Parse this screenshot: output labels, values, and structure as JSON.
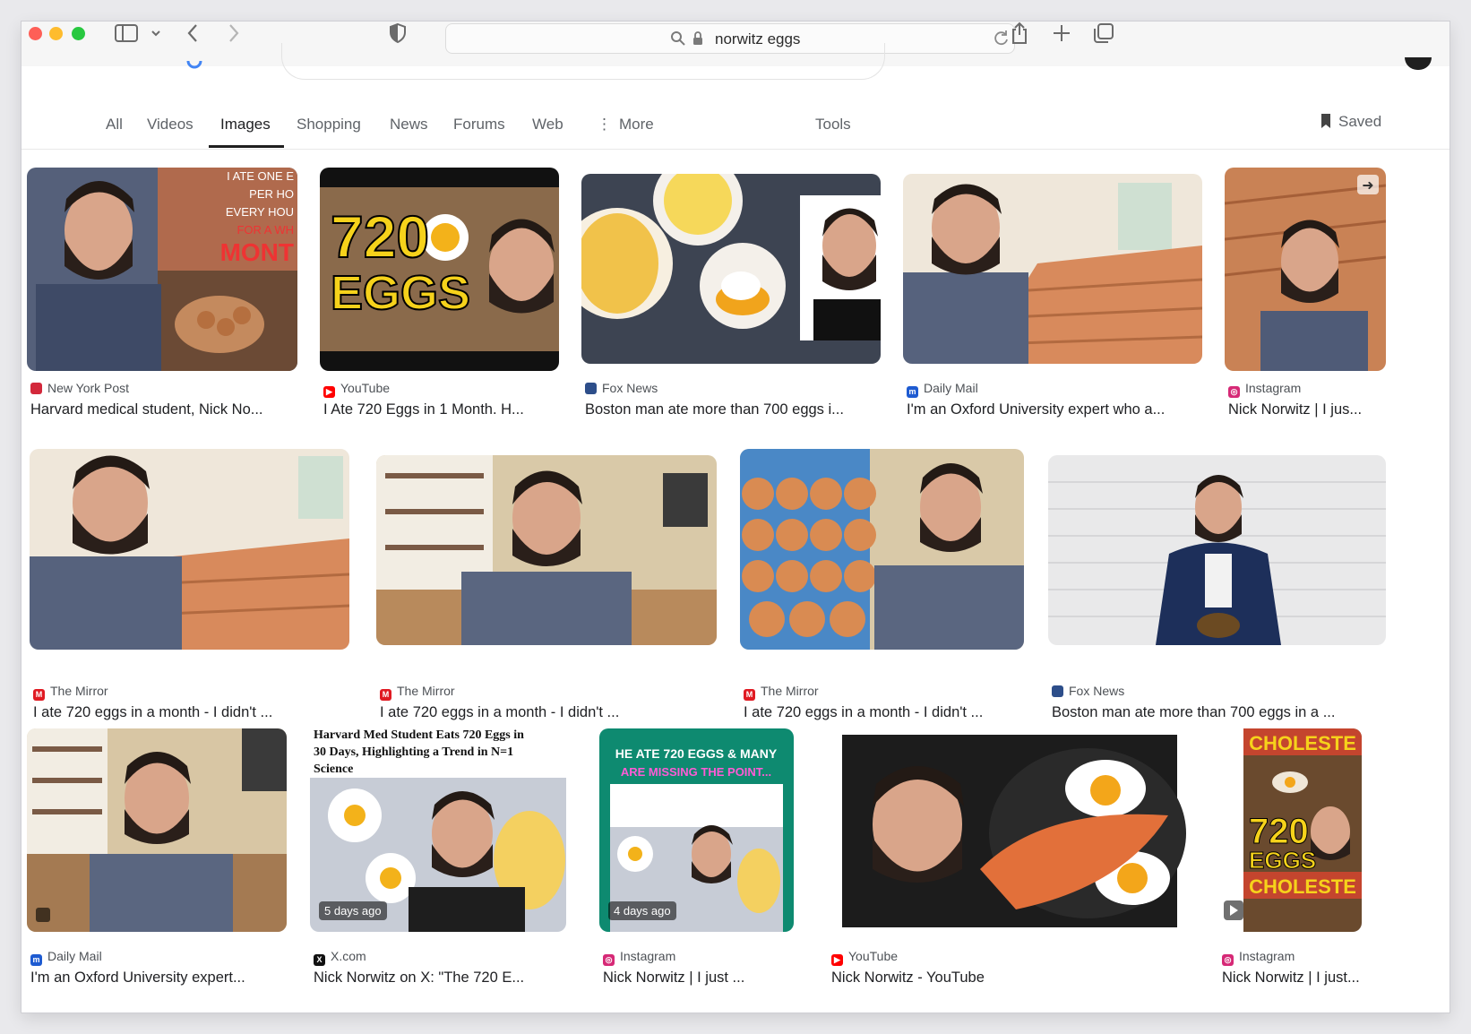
{
  "browser": {
    "url_text": "norwitz eggs",
    "colors": {
      "close": "#fe5f57",
      "minimize": "#febc2e",
      "zoom": "#28c840"
    }
  },
  "tabs": [
    {
      "label": "All"
    },
    {
      "label": "Videos"
    },
    {
      "label": "Images",
      "active": true
    },
    {
      "label": "Shopping"
    },
    {
      "label": "News"
    },
    {
      "label": "Forums"
    },
    {
      "label": "Web"
    },
    {
      "label": "More"
    },
    {
      "label": "Tools"
    }
  ],
  "saved_label": "Saved",
  "results": [
    {
      "source": "New York Post",
      "title": "Harvard medical student, Nick No...",
      "icon": "newspaper-icon",
      "thumb_text": [
        "I ATE ONE E",
        "PER HO",
        "EVERY HOU",
        "FOR A WH",
        "MONT"
      ]
    },
    {
      "source": "YouTube",
      "title": "I Ate 720 Eggs in 1 Month. H...",
      "icon": "youtube-icon",
      "thumb_text": [
        "720",
        "EGGS"
      ]
    },
    {
      "source": "Fox News",
      "title": "Boston man ate more than 700 eggs i...",
      "icon": "fox-news-icon"
    },
    {
      "source": "Daily Mail",
      "title": "I'm an Oxford University expert who a...",
      "icon": "daily-mail-icon"
    },
    {
      "source": "Instagram",
      "title": "Nick Norwitz | I jus...",
      "icon": "instagram-icon"
    },
    {
      "source": "The Mirror",
      "title": "I ate 720 eggs in a month - I didn't ...",
      "icon": "mirror-icon"
    },
    {
      "source": "The Mirror",
      "title": "I ate 720 eggs in a month - I didn't ...",
      "icon": "mirror-icon"
    },
    {
      "source": "The Mirror",
      "title": "I ate 720 eggs in a month - I didn't ...",
      "icon": "mirror-icon"
    },
    {
      "source": "Fox News",
      "title": "Boston man ate more than 700 eggs in a ...",
      "icon": "fox-news-icon"
    },
    {
      "source": "Daily Mail",
      "title": "I'm an Oxford University expert...",
      "icon": "daily-mail-icon"
    },
    {
      "source": "X.com",
      "title": "Nick Norwitz on X: \"The 720 E...",
      "icon": "x-icon",
      "badge": "5 days ago",
      "thumb_text": [
        "Harvard Med Student Eats 720 Eggs in",
        "30 Days, Highlighting a Trend in N=1",
        "Science"
      ]
    },
    {
      "source": "Instagram",
      "title": "Nick Norwitz | I just ...",
      "icon": "instagram-icon",
      "badge": "4 days ago",
      "thumb_text": [
        "HE ATE 720 EGGS & MANY",
        "ARE MISSING THE POINT..."
      ]
    },
    {
      "source": "YouTube",
      "title": "Nick Norwitz - YouTube",
      "icon": "youtube-icon"
    },
    {
      "source": "Instagram",
      "title": "Nick Norwitz | I just...",
      "icon": "instagram-icon",
      "thumb_text": [
        "CHOLESTE",
        "720",
        "EGGS"
      ]
    }
  ]
}
